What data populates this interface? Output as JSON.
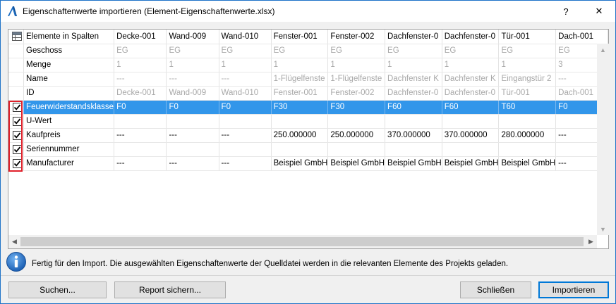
{
  "window": {
    "title": "Eigenschaftenwerte importieren (Element-Eigenschaftenwerte.xlsx)",
    "help_label": "?",
    "close_label": "✕"
  },
  "grid": {
    "header": {
      "label": "Elemente in Spalten",
      "columns": [
        "Decke-001",
        "Wand-009",
        "Wand-010",
        "Fenster-001",
        "Fenster-002",
        "Dachfenster-0",
        "Dachfenster-0",
        "Tür-001",
        "Dach-001"
      ]
    },
    "readonly_rows": [
      {
        "label": "Geschoss",
        "values": [
          "EG",
          "EG",
          "EG",
          "EG",
          "EG",
          "EG",
          "EG",
          "EG",
          "EG"
        ]
      },
      {
        "label": "Menge",
        "values": [
          "1",
          "1",
          "1",
          "1",
          "1",
          "1",
          "1",
          "1",
          "3"
        ]
      },
      {
        "label": "Name",
        "values": [
          "---",
          "---",
          "---",
          "1-Flügelfenste",
          "1-Flügelfenste",
          "Dachfenster K",
          "Dachfenster K",
          "Eingangstür 2",
          "---"
        ]
      },
      {
        "label": "ID",
        "values": [
          "Decke-001",
          "Wand-009",
          "Wand-010",
          "Fenster-001",
          "Fenster-002",
          "Dachfenster-0",
          "Dachfenster-0",
          "Tür-001",
          "Dach-001"
        ]
      }
    ],
    "import_rows": [
      {
        "label": "Feuerwiderstandsklasse",
        "checked": true,
        "selected": true,
        "values": [
          "F0",
          "F0",
          "F0",
          "F30",
          "F30",
          "F60",
          "F60",
          "T60",
          "F0"
        ]
      },
      {
        "label": "U-Wert",
        "checked": true,
        "selected": false,
        "values": [
          "",
          "",
          "",
          "",
          "",
          "",
          "",
          "",
          ""
        ]
      },
      {
        "label": "Kaufpreis",
        "checked": true,
        "selected": false,
        "values": [
          "---",
          "---",
          "---",
          "250.000000",
          "250.000000",
          "370.000000",
          "370.000000",
          "280.000000",
          "---"
        ]
      },
      {
        "label": "Seriennummer",
        "checked": true,
        "selected": false,
        "values": [
          "",
          "",
          "",
          "",
          "",
          "",
          "",
          "",
          ""
        ]
      },
      {
        "label": "Manufacturer",
        "checked": true,
        "selected": false,
        "values": [
          "---",
          "---",
          "---",
          "Beispiel GmbH",
          "Beispiel GmbH",
          "Beispiel GmbH",
          "Beispiel GmbH",
          "Beispiel GmbH",
          "---"
        ]
      }
    ]
  },
  "status": {
    "message": "Fertig für den Import. Die ausgewählten Eigenschaftenwerte der Quelldatei werden in die relevanten Elemente des Projekts geladen."
  },
  "buttons": {
    "search": "Suchen...",
    "save_report": "Report sichern...",
    "close": "Schließen",
    "import": "Importieren"
  },
  "colors": {
    "selection": "#3296ea",
    "highlight_box": "#e0202a",
    "window_border": "#1e73c8"
  }
}
